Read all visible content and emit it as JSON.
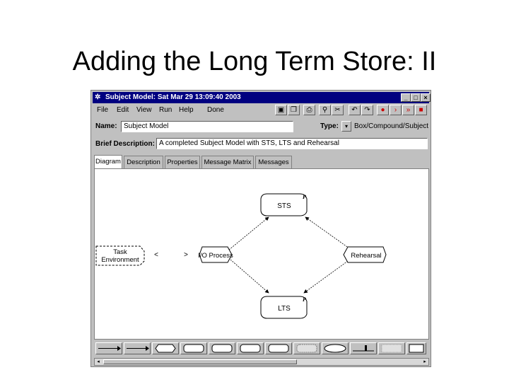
{
  "slide": {
    "title": "Adding the Long Term Store: II"
  },
  "window": {
    "title": "Subject Model: Sat Mar 29 13:09:40 2003",
    "controls": {
      "minimize": "_",
      "maximize": "□",
      "close": "×"
    }
  },
  "menu": {
    "items": [
      "File",
      "Edit",
      "View",
      "Run",
      "Help",
      "Done"
    ]
  },
  "form": {
    "name_label": "Name:",
    "name_value": "Subject Model",
    "type_label": "Type:",
    "type_value": "Box/Compound/Subject",
    "brief_label": "Brief Description:",
    "brief_value": "A completed Subject Model with STS, LTS and Rehearsal"
  },
  "tabs": [
    "Diagram",
    "Description",
    "Properties",
    "Message Matrix",
    "Messages"
  ],
  "active_tab": "Diagram",
  "diagram": {
    "nodes": {
      "sts": "STS",
      "lts": "LTS",
      "io": "I/O Process",
      "rehearsal": "Rehearsal",
      "task": [
        "Task",
        "Environment"
      ]
    },
    "p_marker": "P",
    "io_arrows": "<      >"
  },
  "toolbar_icons": [
    "save-icon",
    "copy-icon",
    "print-icon",
    "find-icon",
    "cut-icon",
    "undo-icon",
    "redo-icon",
    "record-icon",
    "step-icon",
    "run-icon",
    "stop-icon"
  ],
  "colors": {
    "titlebar": "#000080",
    "record": "#cc0000",
    "run": "#cc0000",
    "stop": "#cc0000"
  }
}
